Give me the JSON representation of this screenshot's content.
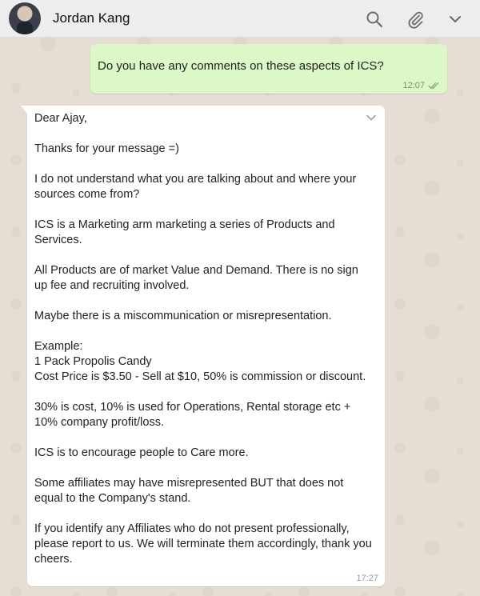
{
  "header": {
    "contact_name": "Jordan Kang",
    "icons": [
      "search-icon",
      "paperclip-icon",
      "chevron-down-icon"
    ]
  },
  "messages": {
    "outgoing": {
      "text": "Do you have any comments on these aspects of ICS?",
      "time": "12:07",
      "status": "read"
    },
    "incoming": {
      "paragraphs": [
        "Dear Ajay,",
        "Thanks for your message =)",
        "I do not understand what you are talking about and where your sources come from?",
        "ICS is a Marketing arm marketing a series of Products and Services.",
        "All Products are of market Value and Demand. There is no sign up fee and recruiting involved.",
        "Maybe there is a miscommunication or misrepresentation.",
        "Example:\n1 Pack Propolis Candy\nCost Price is $3.50 - Sell at $10, 50% is commission or discount.",
        "30% is cost, 10% is used for Operations, Rental storage etc + 10% company profit/loss.",
        "ICS is to encourage people to Care more.",
        "Some affiliates may have misrepresented BUT that does not equal to the Company's stand.",
        "If you identify any Affiliates who do not present professionally, please report to us. We will terminate them accordingly, thank you cheers."
      ],
      "time": "17:27"
    }
  },
  "colors": {
    "outgoing_bubble": "#dcf8c6",
    "incoming_bubble": "#ffffff",
    "chat_background": "#e6ddd4",
    "header_background": "#ededed"
  }
}
